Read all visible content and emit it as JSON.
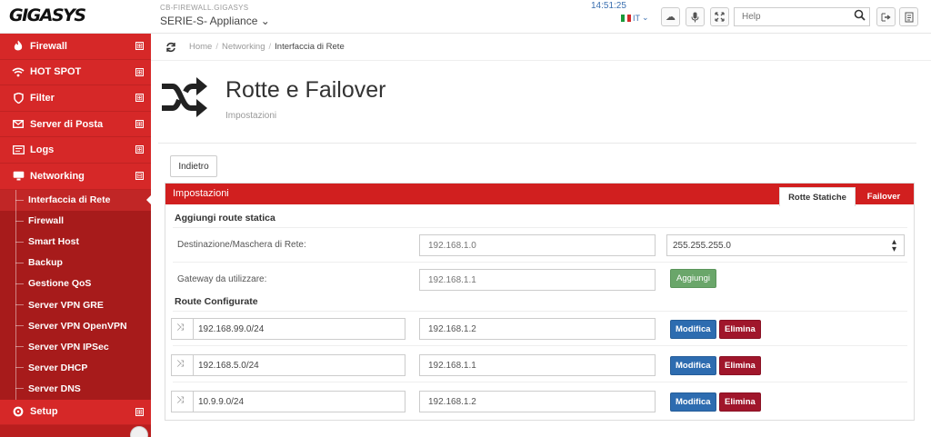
{
  "header": {
    "logo": "GIGASYS",
    "device_sub": "CB-FIREWALL.GIGASYS",
    "device_title": "SERIE-S- Appliance",
    "clock": "14:51:25",
    "lang": "IT",
    "help_placeholder": "Help",
    "icons": [
      "cloud-icon",
      "microphone-icon",
      "fullscreen-icon",
      "search-icon",
      "logout-icon",
      "notes-icon"
    ]
  },
  "sidebar": {
    "items": [
      {
        "label": "Firewall",
        "icon": "flame-icon"
      },
      {
        "label": "HOT SPOT",
        "icon": "wifi-icon"
      },
      {
        "label": "Filter",
        "icon": "shield-icon"
      },
      {
        "label": "Server di Posta",
        "icon": "envelope-icon"
      },
      {
        "label": "Logs",
        "icon": "logs-icon"
      },
      {
        "label": "Networking",
        "icon": "network-icon"
      }
    ],
    "sub_items": [
      {
        "label": "Interfaccia di Rete"
      },
      {
        "label": "Firewall"
      },
      {
        "label": "Smart Host"
      },
      {
        "label": "Backup"
      },
      {
        "label": "Gestione QoS"
      },
      {
        "label": "Server VPN GRE"
      },
      {
        "label": "Server VPN OpenVPN"
      },
      {
        "label": "Server VPN IPSec"
      },
      {
        "label": "Server DHCP"
      },
      {
        "label": "Server DNS"
      }
    ],
    "setup": {
      "label": "Setup",
      "icon": "gear-icon"
    },
    "expand_glyph": "⊞",
    "collapse_glyph": "⊟"
  },
  "breadcrumb": {
    "home": "Home",
    "networking": "Networking",
    "current": "Interfaccia di Rete",
    "separator": "/"
  },
  "page": {
    "title": "Rotte e Failover",
    "subtitle": "Impostazioni",
    "back_label": "Indietro"
  },
  "panel": {
    "title": "Impostazioni",
    "tabs": [
      {
        "label": "Rotte Statiche"
      },
      {
        "label": "Failover"
      }
    ],
    "add_section": "Aggiungi route statica",
    "dest_label": "Destinazione/Maschera di Rete:",
    "dest_placeholder": "192.168.1.0",
    "mask_value": "255.255.255.0",
    "gw_label": "Gateway da utilizzare:",
    "gw_placeholder": "192.168.1.1",
    "add_label": "Aggiungi",
    "routes_section": "Route Configurate",
    "routes": [
      {
        "network": "192.168.99.0/24",
        "gateway": "192.168.1.2"
      },
      {
        "network": "192.168.5.0/24",
        "gateway": "192.168.1.1"
      },
      {
        "network": "10.9.9.0/24",
        "gateway": "192.168.1.2"
      }
    ],
    "edit_label": "Modifica",
    "delete_label": "Elimina"
  }
}
